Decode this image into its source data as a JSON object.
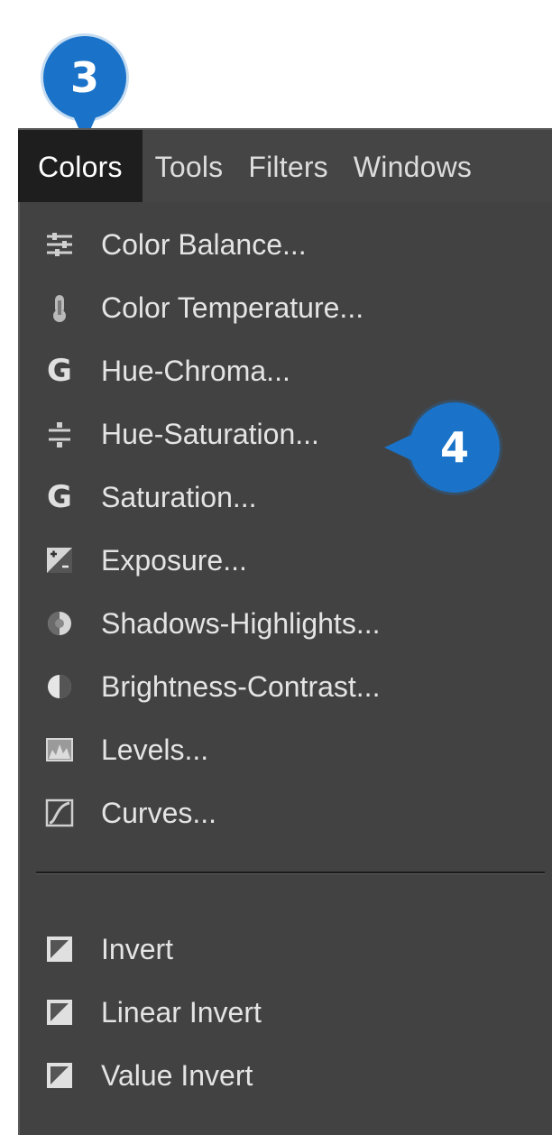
{
  "callouts": {
    "step_a": "3",
    "step_b": "4",
    "color": "#1a73c9"
  },
  "menubar": {
    "items": [
      {
        "label": "Colors",
        "active": true
      },
      {
        "label": "Tools"
      },
      {
        "label": "Filters"
      },
      {
        "label": "Windows"
      }
    ]
  },
  "colors_menu": {
    "items": [
      {
        "label": "Color Balance...",
        "icon": "color-balance-icon"
      },
      {
        "label": "Color Temperature...",
        "icon": "thermometer-icon"
      },
      {
        "label": "Hue-Chroma...",
        "icon": "g-letter-icon"
      },
      {
        "label": "Hue-Saturation...",
        "icon": "hue-saturation-icon"
      },
      {
        "label": "Saturation...",
        "icon": "g-letter-icon"
      },
      {
        "label": "Exposure...",
        "icon": "exposure-icon"
      },
      {
        "label": "Shadows-Highlights...",
        "icon": "shadows-highlights-icon"
      },
      {
        "label": "Brightness-Contrast...",
        "icon": "brightness-contrast-icon"
      },
      {
        "label": "Levels...",
        "icon": "levels-icon"
      },
      {
        "label": "Curves...",
        "icon": "curves-icon"
      }
    ],
    "invert_items": [
      {
        "label": "Invert",
        "icon": "invert-icon"
      },
      {
        "label": "Linear Invert",
        "icon": "invert-icon"
      },
      {
        "label": "Value Invert",
        "icon": "invert-icon"
      }
    ]
  }
}
